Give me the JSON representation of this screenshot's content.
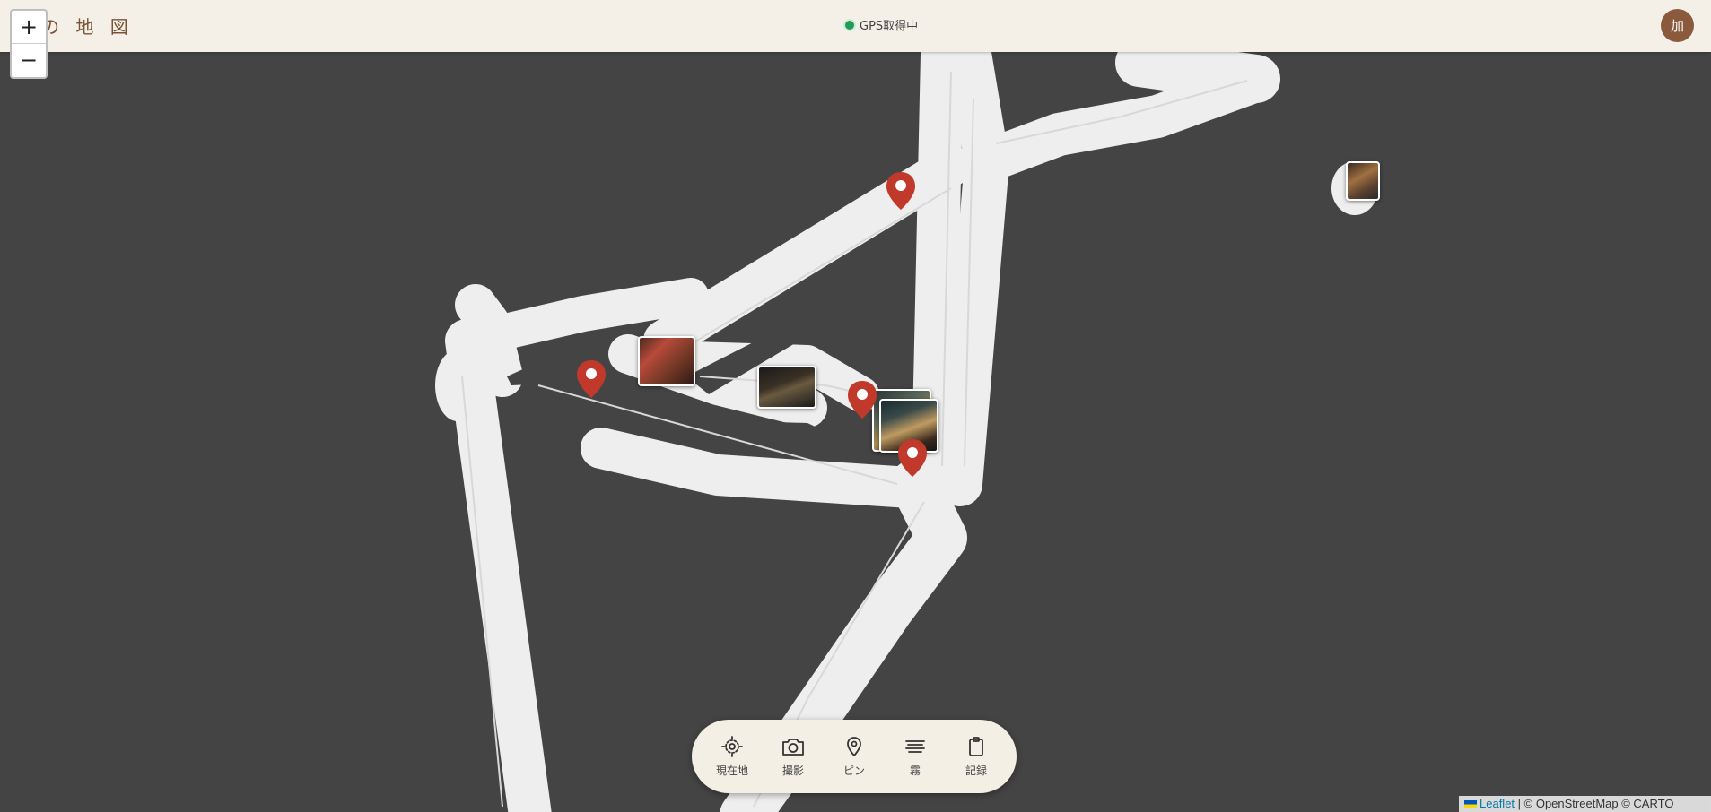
{
  "header": {
    "title": "の 地 図",
    "gps_status": "GPS取得中",
    "avatar_initial": "加"
  },
  "zoom": {
    "in_label": "+",
    "out_label": "−"
  },
  "toolbar": {
    "items": [
      {
        "label": "現在地",
        "icon": "locate-icon"
      },
      {
        "label": "撮影",
        "icon": "camera-icon"
      },
      {
        "label": "ピン",
        "icon": "pin-icon"
      },
      {
        "label": "霧",
        "icon": "fog-icon"
      },
      {
        "label": "記録",
        "icon": "clipboard-icon"
      }
    ]
  },
  "attribution": {
    "leaflet": "Leaflet",
    "rest": " | © OpenStreetMap © CARTO"
  },
  "colors": {
    "fog": "#444444",
    "revealed_road": "#eeeeee",
    "pin": "#c0392b",
    "header_bg": "#f4f0e8",
    "avatar_bg": "#8b5a3c",
    "gps_dot": "#1f9d55"
  }
}
